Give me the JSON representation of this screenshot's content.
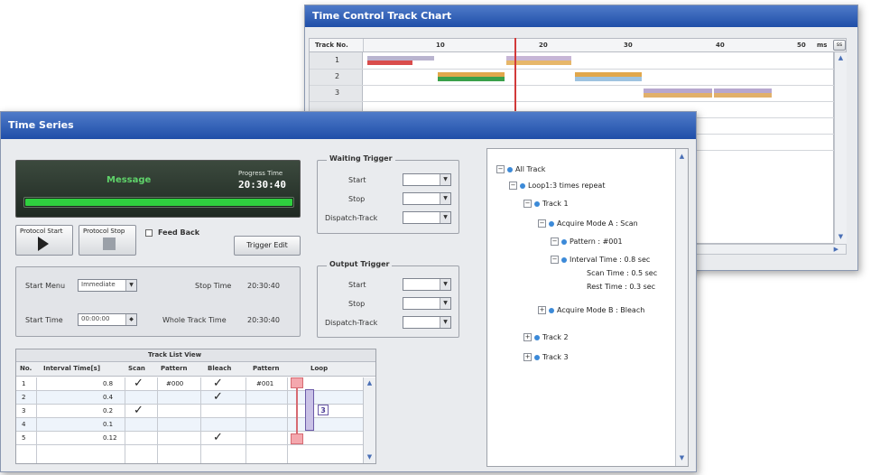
{
  "chart_window": {
    "title": "Time Control Track Chart",
    "track_header": "Track No.",
    "ticks": [
      "10",
      "20",
      "30",
      "40",
      "50"
    ],
    "unit": "ms",
    "unit_btn": "ss",
    "track_rows": [
      "1",
      "2",
      "3"
    ]
  },
  "series_window": {
    "title": "Time Series",
    "message": "Message",
    "progress_label": "Progress Time",
    "progress_time": "20:30:40",
    "progress_fraction": 1.0,
    "protocol_start": "Protocol Start",
    "protocol_stop": "Protocol Stop",
    "feed_back": "Feed Back",
    "trigger_edit": "Trigger Edit",
    "start_menu_label": "Start Menu",
    "start_menu_value": "Immediate",
    "stop_time_label": "Stop Time",
    "stop_time_value": "20:30:40",
    "start_time_label": "Start Time",
    "start_time_value": "00:00:00",
    "whole_track_label": "Whole Track Time",
    "whole_track_value": "20:30:40",
    "waiting_trigger": {
      "legend": "Waiting Trigger",
      "start": "Start",
      "stop": "Stop",
      "dispatch": "Dispatch-Track"
    },
    "output_trigger": {
      "legend": "Output Trigger",
      "start": "Start",
      "stop": "Stop",
      "dispatch": "Dispatch-Track"
    },
    "track_list": {
      "title": "Track List View",
      "headers": [
        "No.",
        "Interval Time[s]",
        "Scan",
        "Pattern",
        "Bleach",
        "Pattern",
        "Loop"
      ],
      "rows": [
        {
          "no": "1",
          "interval": "0.8",
          "scan": "✓",
          "pattern1": "#000",
          "bleach": "✓",
          "pattern2": "#001"
        },
        {
          "no": "2",
          "interval": "0.4",
          "scan": "",
          "pattern1": "",
          "bleach": "✓",
          "pattern2": ""
        },
        {
          "no": "3",
          "interval": "0.2",
          "scan": "✓",
          "pattern1": "",
          "bleach": "",
          "pattern2": ""
        },
        {
          "no": "4",
          "interval": "0.1",
          "scan": "",
          "pattern1": "",
          "bleach": "",
          "pattern2": ""
        },
        {
          "no": "5",
          "interval": "0.12",
          "scan": "",
          "pattern1": "",
          "bleach": "✓",
          "pattern2": ""
        }
      ],
      "loop_inner": "3"
    },
    "tree": {
      "all_track": "All Track",
      "loop": "Loop1:3 times repeat",
      "track1": "Track 1",
      "acquire_a": "Acquire Mode A : Scan",
      "pattern": "Pattern : #001",
      "interval": "Interval Time : 0.8 sec",
      "scan_time": "Scan Time : 0.5 sec",
      "rest_time": "Rest Time : 0.3 sec",
      "acquire_b": "Acquire Mode B : Bleach",
      "track2": "Track 2",
      "track3": "Track 3"
    }
  },
  "colors": {
    "title_start": "#4f7bc9",
    "title_end": "#1f4ea8",
    "progress_green": "#2fcf3f",
    "marker_red": "#d23a3a"
  }
}
